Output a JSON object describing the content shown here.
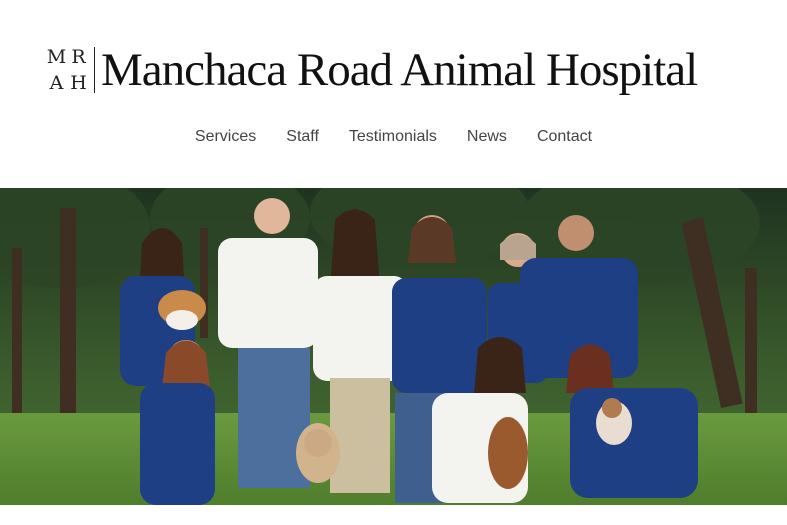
{
  "logo": {
    "monogram": [
      "M",
      "R",
      "A",
      "H"
    ],
    "name": "Manchaca Road Animal Hospital"
  },
  "nav": {
    "items": [
      "Services",
      "Staff",
      "Testimonials",
      "News",
      "Contact"
    ]
  },
  "hero": {
    "description": "",
    "colors": {
      "sky": "#2f4a2a",
      "grass": "#5f8f3a",
      "scrubs": "#1f3f85",
      "white_coat": "#f2f2ee",
      "jeans": "#3f5f8f",
      "khaki": "#cbbf9f"
    }
  }
}
